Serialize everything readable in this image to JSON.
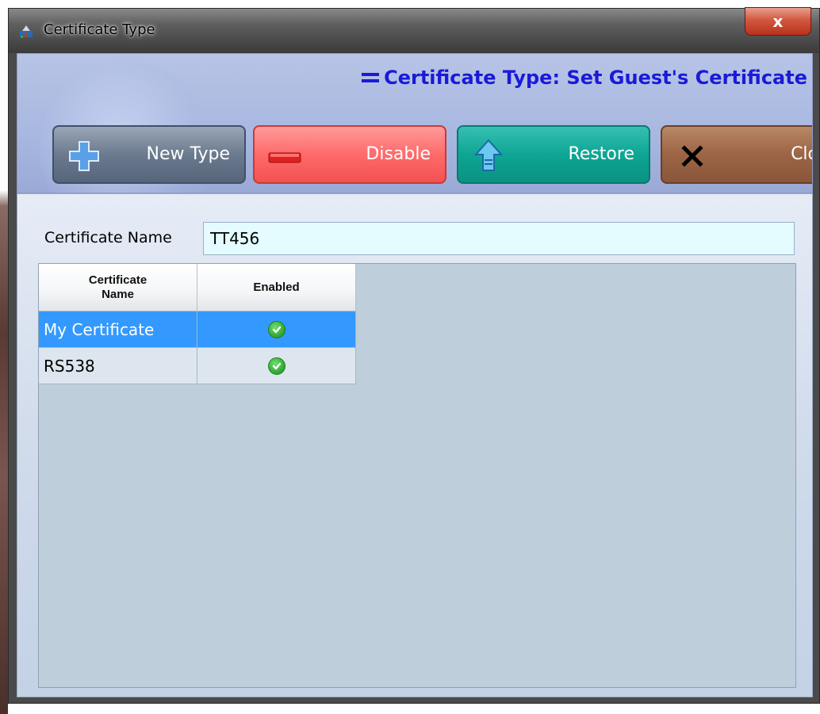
{
  "window": {
    "title": "Certificate Type",
    "close_glyph": "x"
  },
  "header": {
    "title": "Certificate Type: Set Guest's Certificate"
  },
  "toolbar": {
    "new_label": "New Type",
    "disable_label": "Disable",
    "restore_label": "Restore",
    "close_label": "Close"
  },
  "form": {
    "certificate_name_label": "Certificate Name",
    "certificate_name_value": "TT456"
  },
  "table": {
    "columns": [
      "Certificate Name",
      "Enabled"
    ],
    "rows": [
      {
        "name": "My Certificate",
        "enabled": true,
        "selected": true
      },
      {
        "name": "RS538",
        "enabled": true,
        "selected": false
      }
    ]
  },
  "colors": {
    "header_title": "#1a1ad8",
    "selected_row": "#3399ff",
    "input_bg": "#e4fbff",
    "check": "#2fa32f"
  }
}
